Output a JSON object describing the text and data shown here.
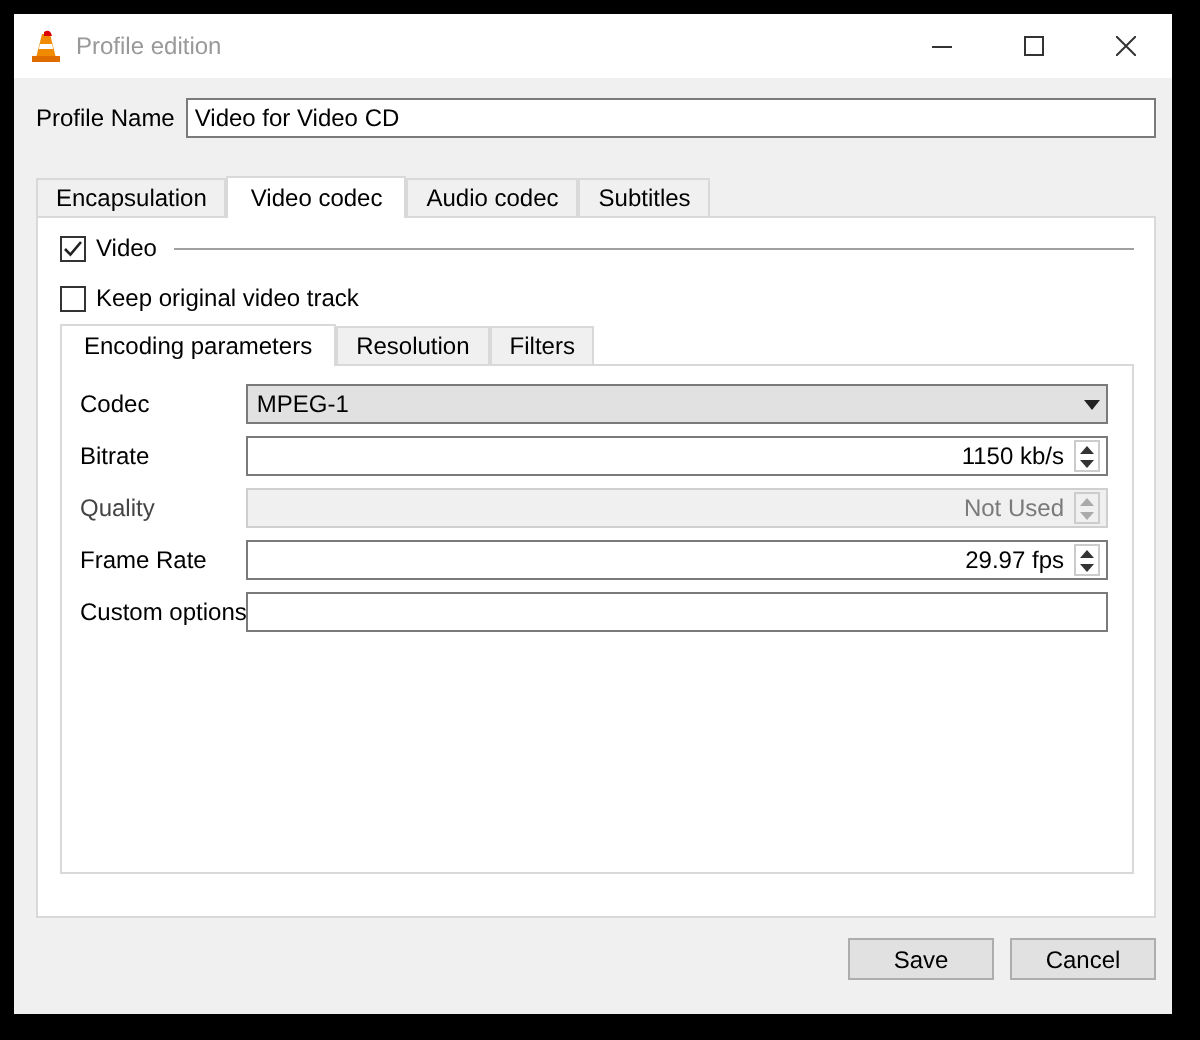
{
  "window": {
    "title": "Profile edition"
  },
  "profile_name": {
    "label": "Profile Name",
    "value": "Video for Video CD"
  },
  "tabs": [
    {
      "label": "Encapsulation",
      "selected": false
    },
    {
      "label": "Video codec",
      "selected": true
    },
    {
      "label": "Audio codec",
      "selected": false
    },
    {
      "label": "Subtitles",
      "selected": false
    }
  ],
  "video": {
    "label": "Video",
    "checked": true
  },
  "keep_original": {
    "label": "Keep original video track",
    "checked": false
  },
  "subtabs": [
    {
      "label": "Encoding parameters",
      "selected": true
    },
    {
      "label": "Resolution",
      "selected": false
    },
    {
      "label": "Filters",
      "selected": false
    }
  ],
  "fields": [
    {
      "label": "Codec",
      "kind": "combo",
      "value": "MPEG-1",
      "disabled": false
    },
    {
      "label": "Bitrate",
      "kind": "spin",
      "value": "1150 kb/s",
      "disabled": false
    },
    {
      "label": "Quality",
      "kind": "spin",
      "value": "Not Used",
      "disabled": true
    },
    {
      "label": "Frame Rate",
      "kind": "spin",
      "value": "29.97 fps",
      "disabled": false
    },
    {
      "label": "Custom options",
      "kind": "text",
      "disabled": false
    }
  ],
  "buttons": [
    "Save",
    "Cancel"
  ]
}
